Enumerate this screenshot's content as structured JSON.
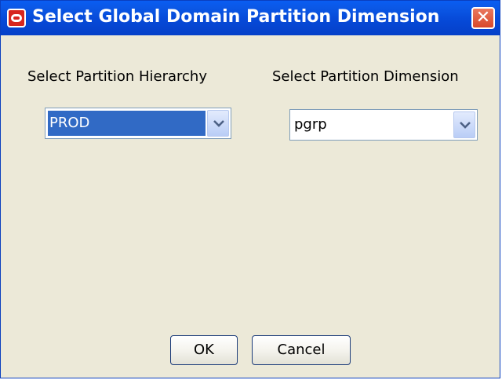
{
  "window": {
    "title": "Select Global Domain Partition Dimension",
    "close_glyph": "✕",
    "icon": "oracle-logo-icon"
  },
  "form": {
    "hierarchy": {
      "label": "Select Partition Hierarchy",
      "selected_value": "PROD"
    },
    "dimension": {
      "label": "Select Partition Dimension",
      "selected_value": "pgrp"
    }
  },
  "buttons": {
    "ok_label": "OK",
    "cancel_label": "Cancel"
  },
  "colors": {
    "titlebar": "#0a5df2",
    "dialog_background": "#ece9d8",
    "selection": "#316ac5",
    "close_button": "#d9482a",
    "app_icon": "#d7261e"
  }
}
